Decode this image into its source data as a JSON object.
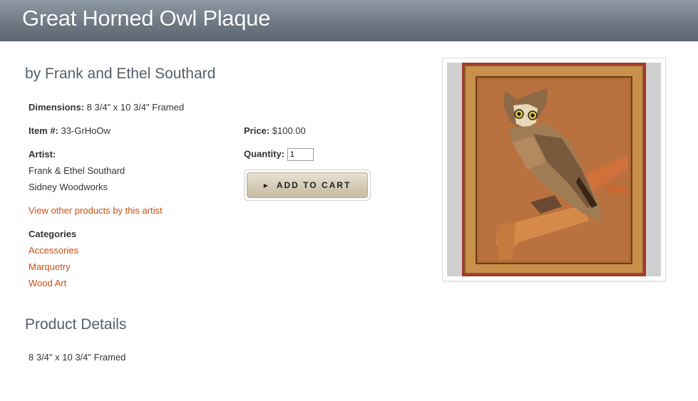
{
  "header": {
    "title": "Great Horned Owl Plaque"
  },
  "byline": "by Frank and Ethel Southard",
  "dimensions": {
    "label": "Dimensions:",
    "value": "8 3/4\" x 10 3/4\" Framed"
  },
  "item": {
    "label": "Item #:",
    "value": "33-GrHoOw"
  },
  "price": {
    "label": "Price:",
    "value": "$100.00"
  },
  "quantity": {
    "label": "Quantity:",
    "value": "1"
  },
  "artist": {
    "label": "Artist:",
    "name": "Frank & Ethel Southard",
    "company": "Sidney Woodworks",
    "other_link": "View other products by this artist"
  },
  "categories": {
    "label": "Categories",
    "items": [
      "Accessories",
      "Marquetry",
      "Wood Art"
    ]
  },
  "cart": {
    "label": "ADD TO CART",
    "icon": "triangle-right-icon"
  },
  "product_details": {
    "title": "Product Details",
    "text": "8 3/4\" x 10 3/4\" Framed"
  },
  "colors": {
    "header_bg": "#6f7a85",
    "link": "#cc4d12",
    "heading": "#555f69"
  }
}
